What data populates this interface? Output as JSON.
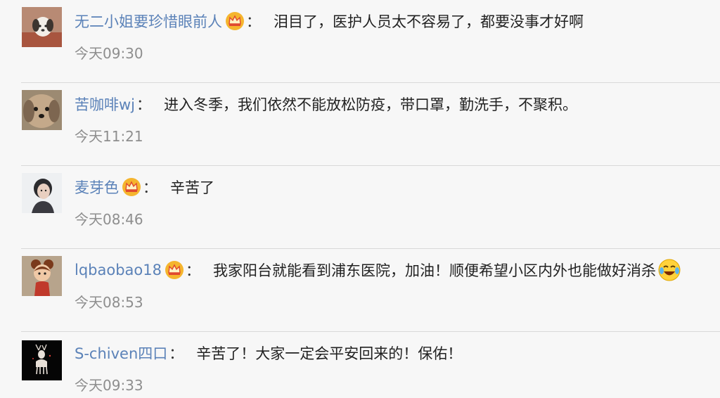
{
  "comments": [
    {
      "user": "无二小姐要珍惜眼前人",
      "crown": true,
      "colon": "：",
      "text": "泪目了，医护人员太不容易了，都要没事才好啊",
      "time": "今天09:30",
      "avatar_icon": "dog-avatar"
    },
    {
      "user": "苦咖啡wj",
      "crown": false,
      "colon": "：",
      "text": "进入冬季，我们依然不能放松防疫，带口罩，勤洗手，不聚积。",
      "time": "今天11:21",
      "avatar_icon": "puppy-avatar"
    },
    {
      "user": "麦芽色",
      "crown": true,
      "colon": "：",
      "text": "辛苦了",
      "time": "今天08:46",
      "avatar_icon": "girl-avatar"
    },
    {
      "user": "lqbaobao18",
      "crown": true,
      "colon": "：",
      "text": "我家阳台就能看到浦东医院，加油！顺便希望小区内外也能做好消杀",
      "time": "今天08:53",
      "avatar_icon": "cartoon-girl-avatar",
      "trailing_emoji": "laughing-tears-emoji"
    },
    {
      "user": "S-chiven四口",
      "crown": false,
      "colon": "：",
      "text": "辛苦了！大家一定会平安回来的！保佑！",
      "time": "今天09:33",
      "avatar_icon": "deer-avatar"
    }
  ],
  "colors": {
    "username": "#5b82b8",
    "text": "#222222",
    "time": "#8e8e8e",
    "background": "#f7f7f7",
    "divider": "#d9d9d9"
  }
}
